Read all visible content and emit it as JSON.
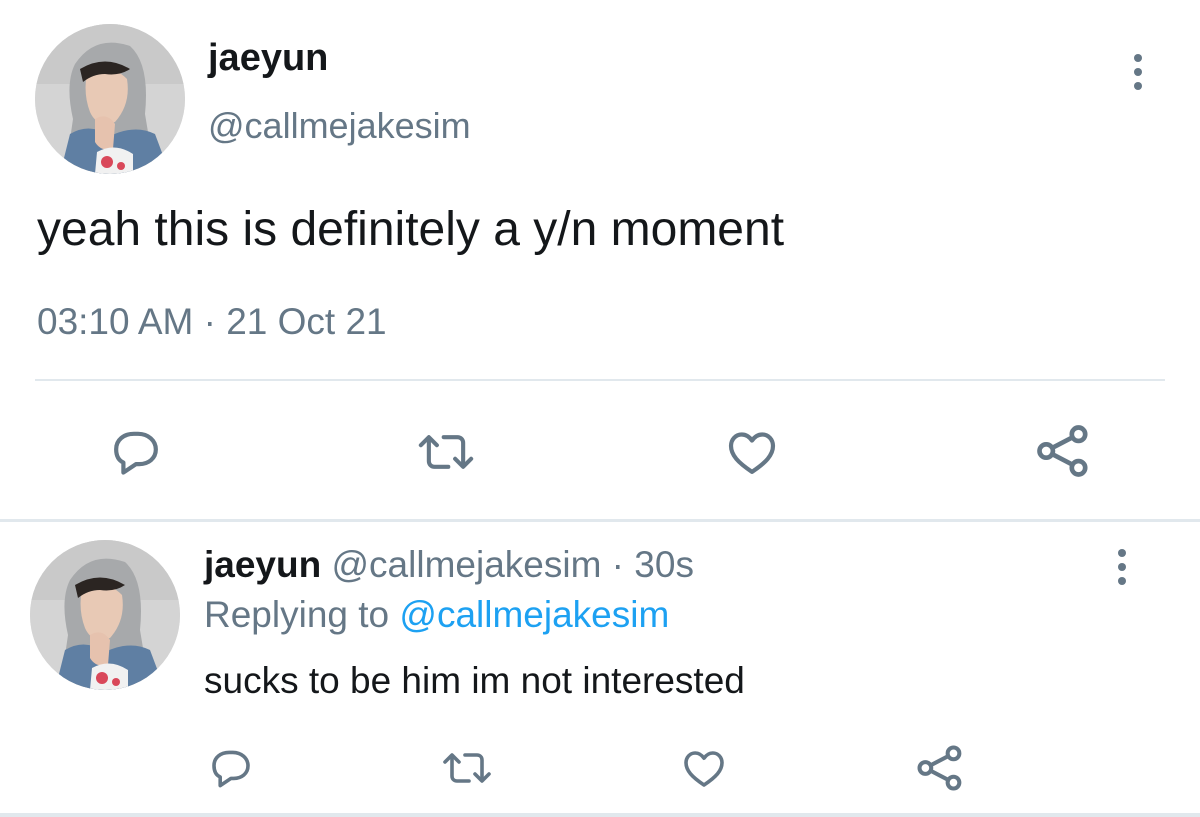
{
  "tweet": {
    "name": "jaeyun",
    "handle": "@callmejakesim",
    "text": "yeah this is definitely a y/n moment",
    "timestamp": "03:10 AM · 21 Oct 21",
    "actions": [
      "reply-icon",
      "retweet-icon",
      "like-icon",
      "share-icon"
    ]
  },
  "reply": {
    "name": "jaeyun",
    "handle": "@callmejakesim",
    "separator": " · ",
    "time": "30s",
    "replying_prefix": "Replying to ",
    "replying_mention": "@callmejakesim",
    "text": "sucks to be him im not interested",
    "actions": [
      "reply-icon",
      "retweet-icon",
      "like-icon",
      "share-icon"
    ]
  },
  "colors": {
    "text": "#14171a",
    "secondary": "#657786",
    "link": "#1da1f2",
    "divider": "#e1e8ed"
  }
}
